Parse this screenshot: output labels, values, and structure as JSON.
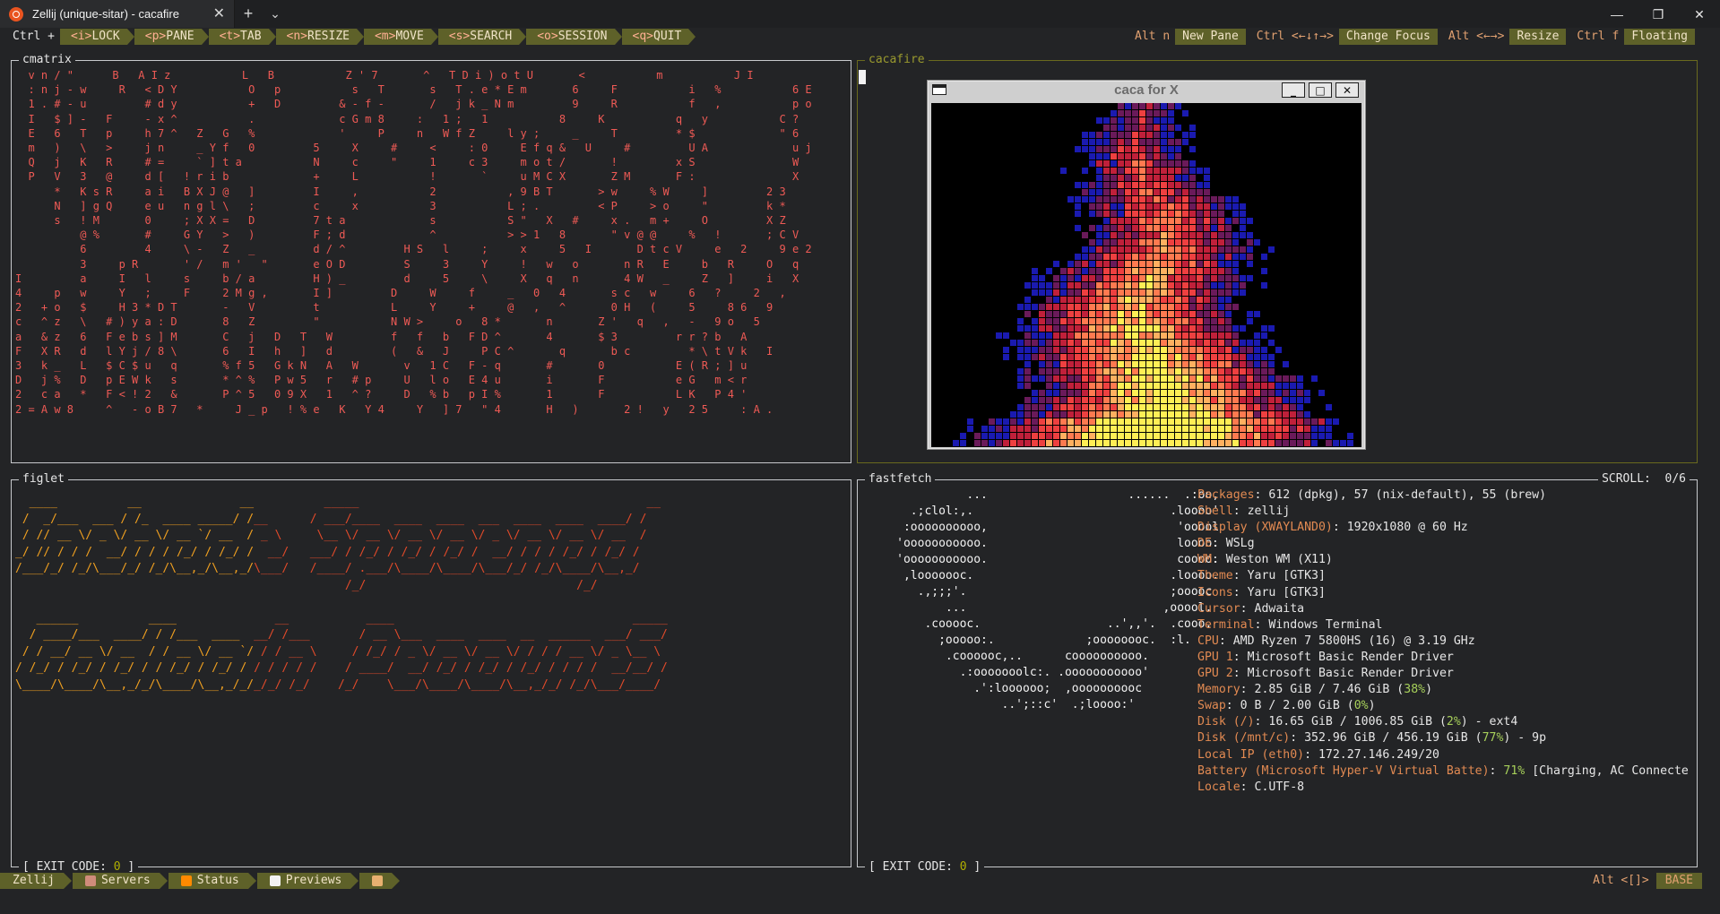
{
  "window": {
    "tab_title": "Zellij (unique-sitar) - cacafire",
    "new_tab": "+",
    "dropdown": "⌄",
    "minimize": "—",
    "restore": "❐",
    "close": "✕"
  },
  "zellij_bar": {
    "prefix": "Ctrl +",
    "modes": [
      {
        "key": "<i>",
        "label": "LOCK"
      },
      {
        "key": "<p>",
        "label": "PANE"
      },
      {
        "key": "<t>",
        "label": "TAB"
      },
      {
        "key": "<n>",
        "label": "RESIZE"
      },
      {
        "key": "<m>",
        "label": "MOVE"
      },
      {
        "key": "<s>",
        "label": "SEARCH"
      },
      {
        "key": "<o>",
        "label": "SESSION"
      },
      {
        "key": "<q>",
        "label": "QUIT"
      }
    ],
    "hints": [
      {
        "key": "Alt n",
        "label": "New Pane"
      },
      {
        "key": "Ctrl <←↓↑→>",
        "label": "Change Focus"
      },
      {
        "key": "Alt <←→>",
        "label": "Resize"
      },
      {
        "key": "Ctrl f",
        "label": "Floating"
      }
    ]
  },
  "panes": {
    "cmatrix": {
      "title": "cmatrix",
      "text": "  v n / \"      B   A I z           L   B           Z ' 7       ^   T D i ) o t U       <           m           J I\n  : n j - w     R   < D Y           O   p           s   T       s   T . e * E m       6     F           i   %           6 E\n  1 . # - u         # d y           +   D         & - f -       /   j k _ N m         9     R           f   ,           p o\n  I   $ ] -   F     - x ^           .             c G m 8     :   1 ;   1           8     K           q   y           C ?\n  E   6   T   p     h 7 ^   Z   G   %             '     P     n   W f Z     l y ;     _     T         * $             \" 6\n  m   )   \\   >     j n     _ Y f   0         5     X     #     <     : 0     E f q &   U     #         U A             u j\n  Q   j   K   R     # =     ` ] t a           N     c     \"     1     c 3     m o t /       !         x S               W\n  P   V   3   @     d [   ! r i b             +     L           !       `     u M C X       Z M       F :               X\n      *   K s R     a i   B X J @   ]         I     ,           2           , 9 B T       > w     % W     ]         2 3\n      N   ] g Q     e u   n g l \\   ;         c     x           3           L ; .         < P     > o     \"         k *\n      s   ! M       0     ; X X =   D         7 t a             s           S \"   X   #     x .   m +     O         X Z\n          @ %       #     G Y   >   )         F ; d             ^           > > 1   8       \" v @ @     %   !       ; C V\n          6         4     \\ -   Z   _         d / ^         H S   l     ;     x     5   I       D t c V     e   2     9 e 2\n          3     p R       ' /   m '   \"       e O D         S     3     Y     !   w   o       n R   E     b   R     O   q\nI         a     I   l     s     b / a         H ) _         d     5     \\     X   q   n       4 W   _     Z   ]     i   X\n4     p   w     Y   ;     F     2 M g ,       I ]         D     W     f     _   0   4       s c   w     6   ?     2   ,\n2   + o   $     H 3 * D T       -   V         t           L     Y     +     @   ,   ^       0 H   (     5     8 6   9\nc   ^ z   \\   # ) y a : D       8   Z         \"           N W >     o   8 *       n       Z '   q   ,   -   9 o   5\na   & z   6   F e b s ] M       C   j   D   T   W         f   f   b   F D ^       4       $ 3         r r ? b   A\nF   X R   d   l Y j / 8 \\       6   I   h   ]   d         (   &   J     P C ^       q       b c         * \\ t V k   I\n3   k _   L   $ C $ u   q       % f 5   G k N   A   W       v   1 C   F - q       #       0           E ( R ; ] u\nD   j %   D   p E W k   s       * ^ %   P w 5   r   # p     U   l o   E 4 u       i       F           e G   m < r\n2   c a   *   F < ! 2   &       P ^ 5   0 9 X   1   ^ ?     D   % b   p I %       1       F           L K   P 4 '\n2 = A w 8     ^   - o B 7   *     J _ p   ! % e   K   Y 4     Y   ] 7   \" 4       H   )       2 !   y   2 5     : A ."
    },
    "cacafire": {
      "title": "cacafire",
      "window_title": "caca for X",
      "btn_min": "_",
      "btn_max": "□",
      "btn_close": "✕"
    },
    "figlet": {
      "title": "figlet",
      "art": "  ____          __              __          _____                                         __\n /  _/___  ___ / /_  ____ _____/ /__      / ___/____  ____  ____  ___  ____  ____  ____/ /\n / // __ \\/ _ \\/ __ \\/ __ `/ __  / _ \\     \\__ \\/ __ \\/ __ \\/ __ \\/ _ \\/ __ \\/ __ \\/ __  /\n_/ // / / /  __/ / / / /_/ / /_/ /  __/   ___/ / /_/ / /_/ / /_/ /  __/ / / / /_/ / /_/ /\n/___/_/ /_/\\___/_/ /_/\\__,_/\\__,_/\\___/   /____/ .___/\\____/\\____/\\___/_/ /_/\\____/\\__,_/\n                                               /_/                              /_/\n\n   ______          ____              __           ____                                  _____\n  / ____/___  ____/ / /___  ____  __/ /___       / __ \\___  ____  ____  __  ______  ___/ ___/\n / / __/ __ \\/ __  / / __ \\/ __ `/ / / __ \\     / /_/ / _ \\/ __ \\/ __ \\/ / / / __ \\/ _ \\__ \\\n/ /_/ / /_/ / /_/ / / /_/ / /_/ / / / / / /    / ____/  __/ /_/ / /_/ / /_/ / / / /  __/__/ /\n\\____/\\____/\\__,_/_/\\____/\\__,_/_/_/_/ /_/    /_/    \\___/\\____/\\____/\\__,_/_/ /_/\\___/____/",
      "exit_label": "[ EXIT CODE: ",
      "exit_code": "0",
      "exit_end": " ]"
    },
    "fastfetch": {
      "title": "fastfetch",
      "scroll_label": "SCROLL:",
      "scroll_value": "0/6",
      "logo": "               ...                    ......  .:oo,\n       .;clol:,.                            .loooo'\n      :oooooooooo,                           'ooool\n     'ooooooooooo.                           loooo.\n     'ooooooooooo.                           coooo.\n      ,looooooc.                            .loooo.\n        .,;;;'.                             ;ooooc\n            ...                            ,ooool.\n         .cooooc.                  ..',,'.  .cooo.\n           ;ooooo:.             ;oooooooc.  :l.\n            .coooooc,..      coooooooooo.\n              .:ooooooolc:. .ooooooooooo'\n                .':loooooo;  ,oooooooooc\n                    ..';::c'  .;loooo:'",
      "info": [
        {
          "k": "Packages",
          "v": ": 612 (dpkg), 57 (nix-default), 55 (brew)"
        },
        {
          "k": "Shell",
          "v": ": zellij"
        },
        {
          "k": "Display (XWAYLAND0)",
          "v": ": 1920x1080 @ 60 Hz"
        },
        {
          "k": "DE",
          "v": ": WSLg"
        },
        {
          "k": "WM",
          "v": ": Weston WM (X11)"
        },
        {
          "k": "Theme",
          "v": ": Yaru [GTK3]"
        },
        {
          "k": "Icons",
          "v": ": Yaru [GTK3]"
        },
        {
          "k": "Cursor",
          "v": ": Adwaita"
        },
        {
          "k": "Terminal",
          "v": ": Windows Terminal"
        },
        {
          "k": "CPU",
          "v": ": AMD Ryzen 7 5800HS (16) @ 3.19 GHz"
        },
        {
          "k": "GPU 1",
          "v": ": Microsoft Basic Render Driver"
        },
        {
          "k": "GPU 2",
          "v": ": Microsoft Basic Render Driver"
        },
        {
          "k": "Memory",
          "v": ": 2.85 GiB / 7.46 GiB (",
          "g": "38%",
          "e": ")"
        },
        {
          "k": "Swap",
          "v": ": 0 B / 2.00 GiB (",
          "g": "0%",
          "e": ")"
        },
        {
          "k": "Disk (/)",
          "v": ": 16.65 GiB / 1006.85 GiB (",
          "g": "2%",
          "e": ") - ext4"
        },
        {
          "k": "Disk (/mnt/c)",
          "v": ": 352.96 GiB / 456.19 GiB (",
          "g": "77%",
          "e": ") - 9p"
        },
        {
          "k": "Local IP (eth0)",
          "v": ": 172.27.146.249/20"
        },
        {
          "k": "Battery (Microsoft Hyper-V Virtual Batte)",
          "v": ": ",
          "g": "71%",
          "e": " [Charging, AC Connecte"
        },
        {
          "k": "Locale",
          "v": ": C.UTF-8"
        }
      ],
      "exit_label": "[ EXIT CODE: ",
      "exit_code": "0",
      "exit_end": " ]"
    }
  },
  "status_bar": {
    "session": "Zellij",
    "tabs": [
      {
        "label": "Servers",
        "icon": "server-icon",
        "color": "#d08c7b"
      },
      {
        "label": "Status",
        "icon": "fire-icon",
        "color": "#ff8a00"
      },
      {
        "label": "Previews",
        "icon": "eyes-icon",
        "color": "#f2f2f2"
      },
      {
        "label": "",
        "icon": "cake-icon",
        "color": "#e8b070"
      }
    ],
    "right_key": "Alt <[]>",
    "mode": "BASE"
  },
  "colors": {
    "accent": "#5e6129",
    "key": "#ffb093",
    "matrix": "#ee5a55",
    "info_key": "#e28a52",
    "percent": "#a7d05a"
  }
}
